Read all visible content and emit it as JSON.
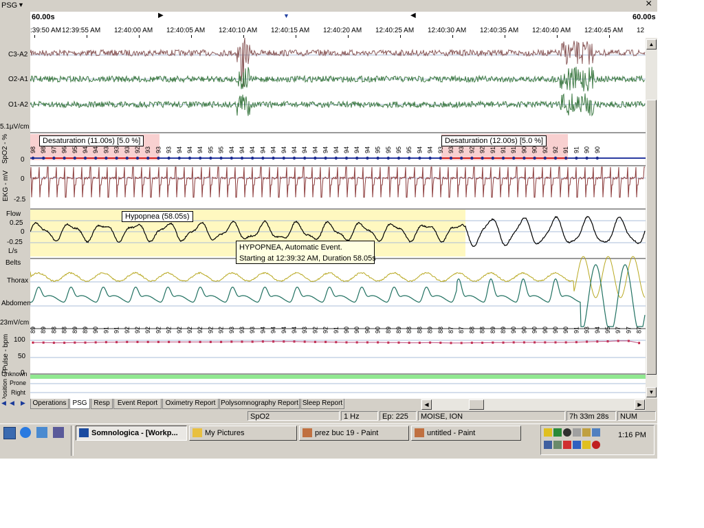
{
  "window": {
    "title": "PSG",
    "close_glyph": "×"
  },
  "timebar": {
    "window_left": "60.00s",
    "window_right": "60.00s",
    "ticks": [
      ":39:50 AM",
      "12:39:55 AM",
      "12:40:00 AM",
      "12:40:05 AM",
      "12:40:10 AM",
      "12:40:15 AM",
      "12:40:20 AM",
      "12:40:25 AM",
      "12:40:30 AM",
      "12:40:35 AM",
      "12:40:40 AM",
      "12:40:45 AM",
      "12"
    ]
  },
  "channels": {
    "eeg": {
      "labels": [
        "C3-A2",
        "O2-A1",
        "O1-A2"
      ],
      "scale": "5.1µV/cm",
      "colors": [
        "#8b5a5a",
        "#3e7a44",
        "#3e7a44"
      ]
    },
    "spo2": {
      "label": "SpO2 - %",
      "zero": "0",
      "values": [
        "98",
        "98",
        "97",
        "96",
        "95",
        "94",
        "94",
        "93",
        "93",
        "93",
        "92",
        "93",
        "93",
        "93",
        "94",
        "94",
        "94",
        "95",
        "95",
        "94",
        "94",
        "94",
        "94",
        "94",
        "94",
        "94",
        "94",
        "94",
        "94",
        "94",
        "94",
        "94",
        "94",
        "95",
        "95",
        "95",
        "95",
        "94",
        "94",
        "93",
        "93",
        "93",
        "92",
        "92",
        "91",
        "91",
        "91",
        "90",
        "90",
        "92",
        "92",
        "91",
        "91",
        "90",
        "90"
      ],
      "desat_events": [
        "Desaturation (11.00s) [5.0 %]",
        "Desaturation (12.00s) [5.0 %]"
      ],
      "event_color": "#f4b0b0"
    },
    "ekg": {
      "label": "EKG - mV",
      "ticks": [
        "0",
        "-2.5"
      ],
      "color": "#8b3a3a"
    },
    "flow": {
      "label": "Flow",
      "units": "L/s",
      "ticks": [
        "0.25",
        "0",
        "-0.25"
      ],
      "hypopnea_label": "Hypopnea (58.05s)",
      "event_color": "#fff8c0"
    },
    "belts": {
      "label": "Belts",
      "thorax": "Thorax",
      "abdomen": "Abdomen",
      "scale": "23mV/cm",
      "thorax_color": "#b8a820",
      "abdomen_color": "#1f7060"
    },
    "pulse": {
      "label": "Pulse - bpm",
      "ticks": [
        "100",
        "50",
        "0"
      ],
      "values": [
        "89",
        "89",
        "88",
        "88",
        "89",
        "89",
        "90",
        "91",
        "91",
        "92",
        "92",
        "92",
        "92",
        "92",
        "92",
        "92",
        "92",
        "92",
        "92",
        "93",
        "93",
        "93",
        "94",
        "94",
        "94",
        "94",
        "93",
        "92",
        "92",
        "91",
        "90",
        "90",
        "90",
        "90",
        "89",
        "89",
        "88",
        "88",
        "89",
        "88",
        "87",
        "87",
        "88",
        "88",
        "89",
        "89",
        "90",
        "90",
        "90",
        "90",
        "90",
        "90",
        "91",
        "93",
        "94",
        "95",
        "97",
        "97",
        "87"
      ]
    },
    "position": {
      "label": "Position - P",
      "items": [
        "Unknown",
        "Prone",
        "Right"
      ],
      "bar_color": "#90e890"
    }
  },
  "tooltip": {
    "line1": "HYPOPNEA, Automatic Event.",
    "line2": "Starting at 12:39:32 AM, Duration 58.05s"
  },
  "tabs": [
    "Operations",
    "PSG",
    "Resp",
    "Event Report",
    "Oximetry Report",
    "Polysomnography Report",
    "Sleep Report"
  ],
  "active_tab": "PSG",
  "status": {
    "channel": "SpO2",
    "rate": "1 Hz",
    "epoch": "Ep: 225",
    "patient": "MOISE, ION",
    "elapsed": "7h 33m 28s",
    "numlock": "NUM"
  },
  "taskbar": {
    "buttons": [
      "Somnologica - [Workp...",
      "My Pictures",
      "prez buc 19 - Paint",
      "untitled - Paint"
    ],
    "clock": "1:16 PM"
  }
}
